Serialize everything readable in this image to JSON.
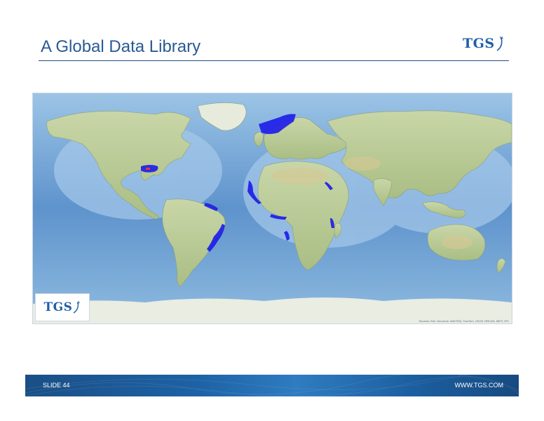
{
  "header": {
    "title": "A Global Data Library",
    "logo_text": "TGS"
  },
  "map": {
    "logo_text": "TGS",
    "credit": "Sources: Esri, DeLorme, NAVTEQ, TomTom, USGS, NRCAN, METI, iPC"
  },
  "footer": {
    "slide_label": "SLIDE 44",
    "website": "WWW.TGS.COM"
  },
  "colors": {
    "title": "#2a5a94",
    "brand_blue": "#1e5fa8",
    "ocean": "#6a9fd2",
    "land": "#bfcf9a",
    "data_coverage": "#1f1ee8"
  }
}
